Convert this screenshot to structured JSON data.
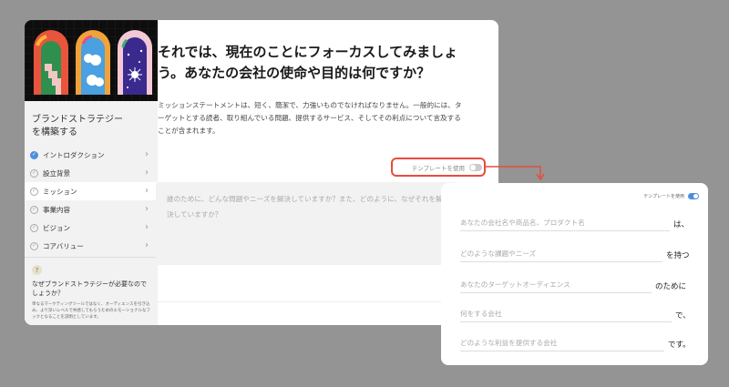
{
  "sidebar": {
    "brand_title": "ブランドストラテジー\nを構築する",
    "items": [
      {
        "label": "イントロダクション",
        "state": "done"
      },
      {
        "label": "設立背景",
        "state": "todo"
      },
      {
        "label": "ミッション",
        "state": "todo",
        "active": true
      },
      {
        "label": "事業内容",
        "state": "todo"
      },
      {
        "label": "ビジョン",
        "state": "todo"
      },
      {
        "label": "コアバリュー",
        "state": "todo"
      }
    ],
    "help_question": "なぜブランドストラテジーが必要なのでしょうか？",
    "help_answer": "単なるマーケティングツールではなく、オーディエンスを引き込み、より深いレベルで共感してもらうためのエモーショナルなフックとなることを説明としています。"
  },
  "main": {
    "title": "それでは、現在のことにフォーカスしてみましょう。あなたの会社の使命や目的は何ですか？",
    "description": "ミッションステートメントは、短く、簡潔で、力強いものでなければなりません。一般的には、ターゲットとする読者、取り組んでいる問題、提供するサービス、そしてその利点について言及することが含まれます。",
    "template_label": "テンプレートを使用",
    "template_on": false,
    "textarea_placeholder": "誰のために、どんな問題やニーズを解決していますか？また、どのように、なぜそれを解決していますか？"
  },
  "panel": {
    "template_label": "テンプレートを使用",
    "template_on": true,
    "rows": [
      {
        "placeholder": "あなたの会社名や商品名、プロダクト名",
        "suffix": "は、"
      },
      {
        "placeholder": "どのような課題やニーズ",
        "suffix": "を持つ"
      },
      {
        "placeholder": "あなたのターゲットオーディエンス",
        "suffix": "のために"
      },
      {
        "placeholder": "何をする会社",
        "suffix": "で、"
      },
      {
        "placeholder": "どのような利益を提供する会社",
        "suffix": "です。"
      }
    ]
  },
  "colors": {
    "accent": "#4a8fe0",
    "highlight": "#e84c3d",
    "backdrop": "#949494"
  },
  "icons": {
    "done": "check-icon",
    "todo": "circle-check-icon",
    "chevron": "chevron-right-icon",
    "help": "lightbulb-icon"
  }
}
